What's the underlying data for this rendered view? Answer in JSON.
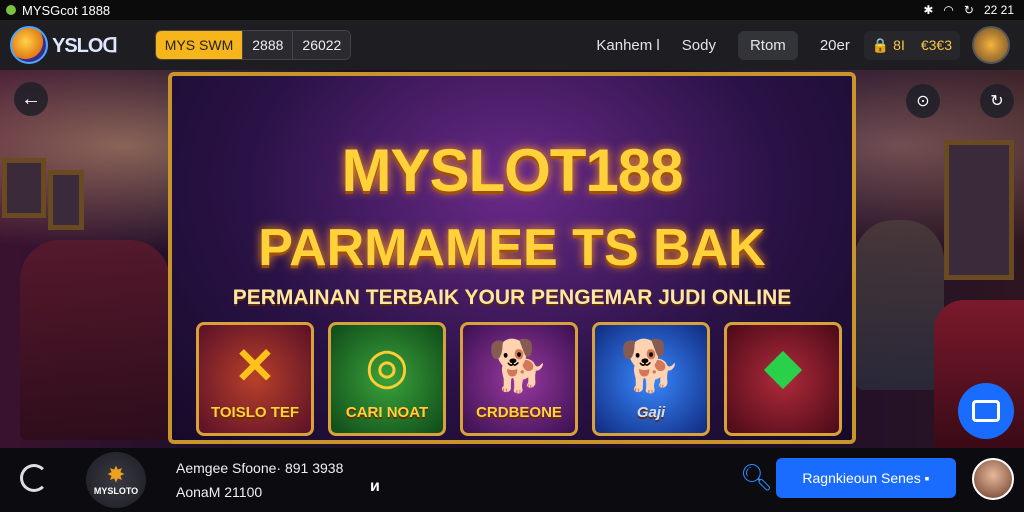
{
  "statusbar": {
    "app_name": "MYSGcot 1888",
    "time": "22 21"
  },
  "header": {
    "logo_text": "YSLOᗡ",
    "pills": [
      "MYS SWM",
      "2888",
      "26022"
    ],
    "nav": [
      "Kanhem l",
      "Sody",
      "Rtom",
      "20er"
    ],
    "wallet": [
      "🔒 8I",
      "€3€3"
    ]
  },
  "banner": {
    "title": "MYSLOT188",
    "subtitle": "PARMAMEE TS BAK",
    "tagline": "PERMAINAN TERBAIK YOUR PENGEMAR JUDI ONLINE",
    "tiles": [
      {
        "label": "TOISLO TEF",
        "icon": "x-icon",
        "bg": "#7a1a3a"
      },
      {
        "label": "CARI NOAT",
        "icon": "coin-icon",
        "bg": "#1f6a2a"
      },
      {
        "label": "CRDBEONE",
        "icon": "shiba-icon",
        "bg": "#6a2a7a"
      },
      {
        "label": "Gaji",
        "icon": "shiba-icon",
        "bg": "#1a3a9a"
      },
      {
        "label": "",
        "icon": "gem-icon",
        "bg": "#6a1a2a"
      }
    ]
  },
  "footer": {
    "logo_name": "MYSLOTO",
    "line1": "Aemgee Sfoone· 891 3938",
    "line2": "AonaM 21100",
    "close": "ᴎ",
    "button": "Ragnkieoun Senes ▪"
  }
}
